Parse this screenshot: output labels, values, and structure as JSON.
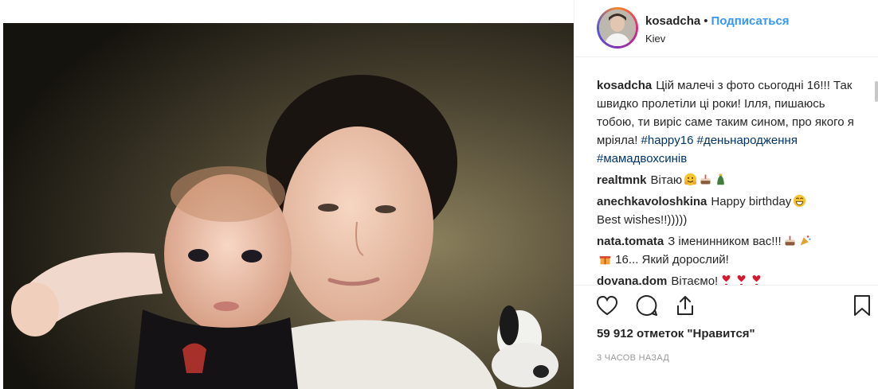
{
  "post": {
    "username": "kosadcha",
    "separator": "•",
    "follow_label": "Подписаться",
    "location": "Kiev",
    "caption_text": "Цій малечі з фото сьогодні 16!!! Так швидко пролетіли ці роки! Ілля, пишаюсь тобою, ти виріс саме таким сином, про якого я мріяла!",
    "hashtags": [
      "#happy16",
      "#деньнародження",
      "#мамадвохсинів"
    ]
  },
  "comments": [
    {
      "user": "realtmnk",
      "text": "Вітаю",
      "emojis": [
        "hug-emoji",
        "cake-emoji",
        "champagne-emoji"
      ]
    },
    {
      "user": "anechkavoloshkina",
      "text": "Happy birthday",
      "emojis": [
        "grin-emoji"
      ],
      "text2": "Best wishes!!)))))"
    },
    {
      "user": "nata.tomata",
      "text": "З іменинником вас!!!",
      "emojis": [
        "cake-emoji",
        "party-popper-emoji"
      ],
      "text2": "16... Який дорослий!",
      "emoji_before_text2": "gift-emoji"
    },
    {
      "user": "dovana.dom",
      "text": "Вітаємо!",
      "emojis": [
        "heart-exclamation-emoji",
        "heart-exclamation-emoji",
        "heart-exclamation-emoji"
      ]
    }
  ],
  "actions": {
    "icons": [
      "heart-icon",
      "comment-icon",
      "share-icon",
      "bookmark-icon"
    ]
  },
  "likes_text": "59 912 отметок \"Нравится\"",
  "timestamp": "3 ЧАСОВ НАЗАД",
  "colors": {
    "link_blue": "#3897f0",
    "hashtag": "#003569",
    "heart_red": "#d7192f"
  }
}
